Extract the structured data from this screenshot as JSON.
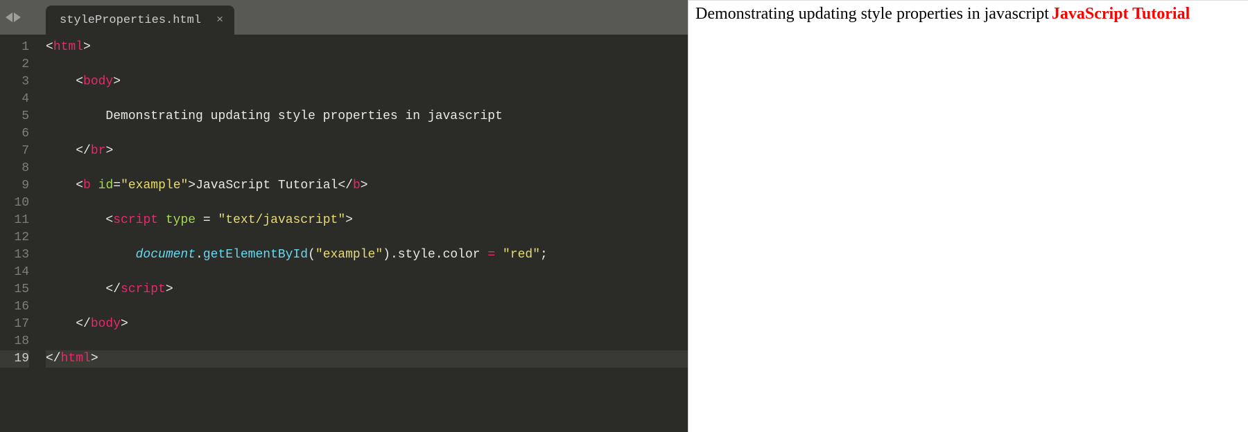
{
  "tab": {
    "filename": "styleProperties.html",
    "close": "×"
  },
  "nav": {
    "left": "◀",
    "right": "▶"
  },
  "lineCount": 19,
  "currentLine": 19,
  "code": {
    "l1": {
      "p1": "<",
      "tag1": "html",
      "p2": ">"
    },
    "l3": {
      "indent": "    ",
      "p1": "<",
      "tag1": "body",
      "p2": ">"
    },
    "l5": {
      "indent": "        ",
      "text": "Demonstrating updating style properties in javascript"
    },
    "l7": {
      "indent": "    ",
      "p1": "</",
      "tag1": "br",
      "p2": ">"
    },
    "l9": {
      "indent": "    ",
      "p1": "<",
      "tag1": "b",
      "sp1": " ",
      "attr1": "id",
      "eq1": "=",
      "str1": "\"example\"",
      "p2": ">",
      "text": "JavaScript Tutorial",
      "p3": "</",
      "tag2": "b",
      "p4": ">"
    },
    "l11": {
      "indent": "        ",
      "p1": "<",
      "tag1": "script",
      "sp1": " ",
      "attr1": "type",
      "eq1": " = ",
      "str1": "\"text/javascript\"",
      "p2": ">"
    },
    "l13": {
      "indent": "            ",
      "obj": "document",
      "dot1": ".",
      "m1": "getElementById",
      "p1": "(",
      "str1": "\"example\"",
      "p2": ")",
      "dot2": ".",
      "prop1": "style",
      "dot3": ".",
      "prop2": "color",
      "sp1": " ",
      "op": "=",
      "sp2": " ",
      "str2": "\"red\"",
      "semi": ";"
    },
    "l15": {
      "indent": "        ",
      "p1": "</",
      "tag1": "script",
      "p2": ">"
    },
    "l17": {
      "indent": "    ",
      "p1": "</",
      "tag1": "body",
      "p2": ">"
    },
    "l19": {
      "p1": "</",
      "tag1": "html",
      "p2": ">"
    }
  },
  "preview": {
    "text": "Demonstrating updating style properties in javascript",
    "bold": "JavaScript Tutorial",
    "boldColor": "red"
  }
}
